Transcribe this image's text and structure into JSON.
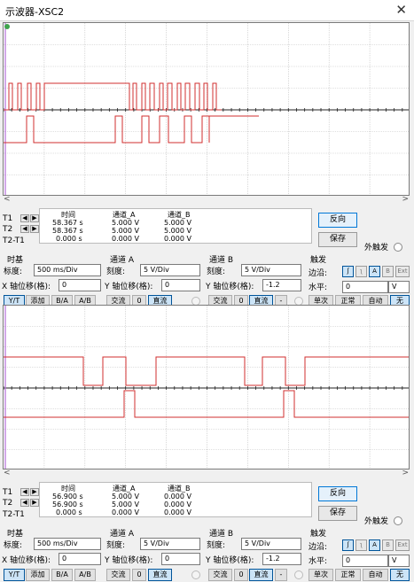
{
  "window": {
    "title": "示波器-XSC2",
    "close_glyph": "✕"
  },
  "colors": {
    "trace": "#d22f2f",
    "grid": "#bfbfbf",
    "axis": "#222222",
    "cursor": "#b56fd8"
  },
  "scroll": {
    "left": "<",
    "right": ">"
  },
  "panels": [
    {
      "cursor": {
        "labels": {
          "t1": "T1",
          "t2": "T2",
          "diff": "T2-T1"
        },
        "headers": {
          "time": "时间",
          "ch_a": "通道_A",
          "ch_b": "通道_B"
        },
        "t1": {
          "time": "58.367 s",
          "a": "5.000 V",
          "b": "5.000 V"
        },
        "t2": {
          "time": "58.367 s",
          "a": "5.000 V",
          "b": "5.000 V"
        },
        "diff": {
          "time": "0.000 s",
          "a": "0.000 V",
          "b": "0.000 V"
        }
      },
      "buttons": {
        "reverse": "反向",
        "save": "保存",
        "ext_trigger": "外触发"
      },
      "timebase": {
        "title": "时基",
        "scale_label": "标度:",
        "scale": "500 ms/Div",
        "xpos_label": "X 轴位移(格):",
        "xpos": "0",
        "modes": [
          "Y/T",
          "添加",
          "B/A",
          "A/B"
        ]
      },
      "channel_a": {
        "title": "通道 A",
        "scale_label": "刻度:",
        "scale": "5  V/Div",
        "ypos_label": "Y 轴位移(格):",
        "ypos": "0",
        "coupling": [
          "交流",
          "0",
          "直流"
        ]
      },
      "channel_b": {
        "title": "通道 B",
        "scale_label": "刻度:",
        "scale": "5  V/Div",
        "ypos_label": "Y 轴位移(格):",
        "ypos": "-1.2",
        "coupling": [
          "交流",
          "0",
          "直流",
          "-"
        ]
      },
      "trigger": {
        "title": "触发",
        "edge_label": "边沿:",
        "level_label": "水平:",
        "level": "0",
        "unit": "V",
        "edge_buttons": [
          "ʃ",
          "ʅ",
          "A",
          "B",
          "Ext"
        ],
        "modes": [
          "单次",
          "正常",
          "自动",
          "无"
        ]
      }
    },
    {
      "cursor": {
        "labels": {
          "t1": "T1",
          "t2": "T2",
          "diff": "T2-T1"
        },
        "headers": {
          "time": "时间",
          "ch_a": "通道_A",
          "ch_b": "通道_B"
        },
        "t1": {
          "time": "56.900 s",
          "a": "5.000 V",
          "b": "0.000 V"
        },
        "t2": {
          "time": "56.900 s",
          "a": "5.000 V",
          "b": "0.000 V"
        },
        "diff": {
          "time": "0.000 s",
          "a": "0.000 V",
          "b": "0.000 V"
        }
      },
      "buttons": {
        "reverse": "反向",
        "save": "保存",
        "ext_trigger": "外触发"
      },
      "timebase": {
        "title": "时基",
        "scale_label": "标度:",
        "scale": "500 ms/Div",
        "xpos_label": "X 轴位移(格):",
        "xpos": "0",
        "modes": [
          "Y/T",
          "添加",
          "B/A",
          "A/B"
        ]
      },
      "channel_a": {
        "title": "通道 A",
        "scale_label": "刻度:",
        "scale": "5  V/Div",
        "ypos_label": "Y 轴位移(格):",
        "ypos": "0",
        "coupling": [
          "交流",
          "0",
          "直流"
        ]
      },
      "channel_b": {
        "title": "通道 B",
        "scale_label": "刻度:",
        "scale": "5  V/Div",
        "ypos_label": "Y 轴位移(格):",
        "ypos": "-1.2",
        "coupling": [
          "交流",
          "0",
          "直流",
          "-"
        ]
      },
      "trigger": {
        "title": "触发",
        "edge_label": "边沿:",
        "level_label": "水平:",
        "level": "0",
        "unit": "V",
        "edge_buttons": [
          "ʃ",
          "ʅ",
          "A",
          "B",
          "Ext"
        ],
        "modes": [
          "单次",
          "正常",
          "自动",
          "无"
        ]
      }
    }
  ]
}
